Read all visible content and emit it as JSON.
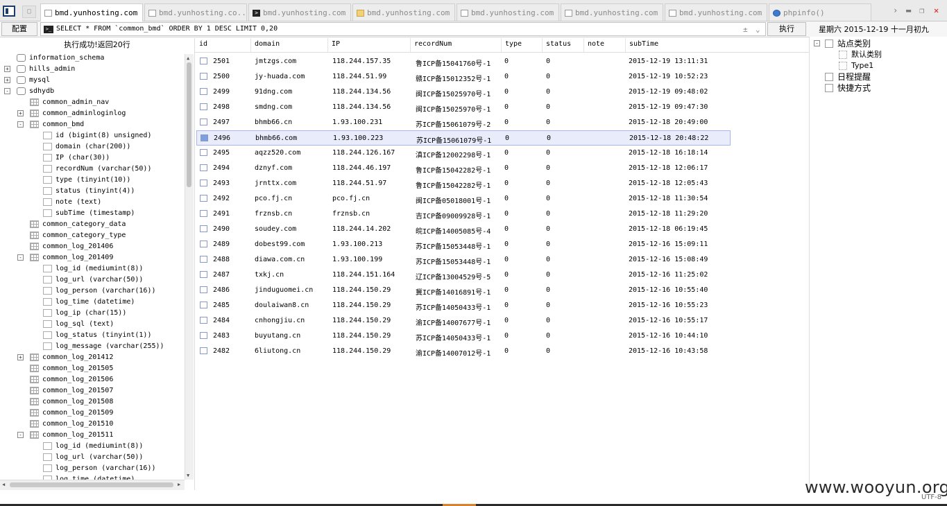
{
  "tabs": [
    {
      "label": "bmd.yunhosting.com",
      "icon": "page-icon",
      "active": true
    },
    {
      "label": "bmd.yunhosting.co...",
      "icon": "page-icon",
      "active": false
    },
    {
      "label": "bmd.yunhosting.com",
      "icon": "terminal-icon",
      "active": false
    },
    {
      "label": "bmd.yunhosting.com",
      "icon": "folder-icon",
      "active": false
    },
    {
      "label": "bmd.yunhosting.com",
      "icon": "page-icon",
      "active": false
    },
    {
      "label": "bmd.yunhosting.com",
      "icon": "page-icon",
      "active": false
    },
    {
      "label": "bmd.yunhosting.com",
      "icon": "page-icon",
      "active": false
    },
    {
      "label": "phpinfo()",
      "icon": "globe-icon",
      "active": false
    }
  ],
  "toolbar": {
    "config_label": "配置",
    "sql_query": "SELECT * FROM `common_bmd` ORDER BY 1 DESC LIMIT 0,20",
    "execute_label": "执行",
    "date_text": "星期六 2015-12-19 十一月初九"
  },
  "status_message": "执行成功!返回20行",
  "tree": [
    {
      "label": "information_schema",
      "level": 0,
      "expander": "",
      "icon": "database-icon"
    },
    {
      "label": "hills_admin",
      "level": 0,
      "expander": "+",
      "icon": "database-icon"
    },
    {
      "label": "mysql",
      "level": 0,
      "expander": "+",
      "icon": "database-icon"
    },
    {
      "label": "sdhydb",
      "level": 0,
      "expander": "-",
      "icon": "database-icon"
    },
    {
      "label": "common_admin_nav",
      "level": 1,
      "expander": "",
      "icon": "table-icon"
    },
    {
      "label": "common_adminloginlog",
      "level": 1,
      "expander": "+",
      "icon": "table-icon"
    },
    {
      "label": "common_bmd",
      "level": 1,
      "expander": "-",
      "icon": "table-icon"
    },
    {
      "label": "id (bigint(8) unsigned)",
      "level": 2,
      "expander": "",
      "icon": "column-icon"
    },
    {
      "label": "domain (char(200))",
      "level": 2,
      "expander": "",
      "icon": "column-icon"
    },
    {
      "label": "IP (char(30))",
      "level": 2,
      "expander": "",
      "icon": "column-icon"
    },
    {
      "label": "recordNum (varchar(50))",
      "level": 2,
      "expander": "",
      "icon": "column-icon"
    },
    {
      "label": "type (tinyint(10))",
      "level": 2,
      "expander": "",
      "icon": "column-icon"
    },
    {
      "label": "status (tinyint(4))",
      "level": 2,
      "expander": "",
      "icon": "column-icon"
    },
    {
      "label": "note (text)",
      "level": 2,
      "expander": "",
      "icon": "column-icon"
    },
    {
      "label": "subTime (timestamp)",
      "level": 2,
      "expander": "",
      "icon": "column-icon"
    },
    {
      "label": "common_category_data",
      "level": 1,
      "expander": "",
      "icon": "table-icon"
    },
    {
      "label": "common_category_type",
      "level": 1,
      "expander": "",
      "icon": "table-icon"
    },
    {
      "label": "common_log_201406",
      "level": 1,
      "expander": "",
      "icon": "table-icon"
    },
    {
      "label": "common_log_201409",
      "level": 1,
      "expander": "-",
      "icon": "table-icon"
    },
    {
      "label": "log_id (mediumint(8))",
      "level": 2,
      "expander": "",
      "icon": "column-icon"
    },
    {
      "label": "log_url (varchar(50))",
      "level": 2,
      "expander": "",
      "icon": "column-icon"
    },
    {
      "label": "log_person (varchar(16))",
      "level": 2,
      "expander": "",
      "icon": "column-icon"
    },
    {
      "label": "log_time (datetime)",
      "level": 2,
      "expander": "",
      "icon": "column-icon"
    },
    {
      "label": "log_ip (char(15))",
      "level": 2,
      "expander": "",
      "icon": "column-icon"
    },
    {
      "label": "log_sql (text)",
      "level": 2,
      "expander": "",
      "icon": "column-icon"
    },
    {
      "label": "log_status (tinyint(1))",
      "level": 2,
      "expander": "",
      "icon": "column-icon"
    },
    {
      "label": "log_message (varchar(255))",
      "level": 2,
      "expander": "",
      "icon": "column-icon"
    },
    {
      "label": "common_log_201412",
      "level": 1,
      "expander": "+",
      "icon": "table-icon"
    },
    {
      "label": "common_log_201505",
      "level": 1,
      "expander": "",
      "icon": "table-icon"
    },
    {
      "label": "common_log_201506",
      "level": 1,
      "expander": "",
      "icon": "table-icon"
    },
    {
      "label": "common_log_201507",
      "level": 1,
      "expander": "",
      "icon": "table-icon"
    },
    {
      "label": "common_log_201508",
      "level": 1,
      "expander": "",
      "icon": "table-icon"
    },
    {
      "label": "common_log_201509",
      "level": 1,
      "expander": "",
      "icon": "table-icon"
    },
    {
      "label": "common_log_201510",
      "level": 1,
      "expander": "",
      "icon": "table-icon"
    },
    {
      "label": "common_log_201511",
      "level": 1,
      "expander": "-",
      "icon": "table-icon"
    },
    {
      "label": "log_id (mediumint(8))",
      "level": 2,
      "expander": "",
      "icon": "column-icon"
    },
    {
      "label": "log_url (varchar(50))",
      "level": 2,
      "expander": "",
      "icon": "column-icon"
    },
    {
      "label": "log_person (varchar(16))",
      "level": 2,
      "expander": "",
      "icon": "column-icon"
    },
    {
      "label": "log_time (datetime)",
      "level": 2,
      "expander": "",
      "icon": "column-icon"
    }
  ],
  "grid": {
    "columns": [
      "id",
      "domain",
      "IP",
      "recordNum",
      "type",
      "status",
      "note",
      "subTime"
    ],
    "selected_row": 5,
    "rows": [
      [
        "2501",
        "jmtzgs.com",
        "118.244.157.35",
        "鲁ICP备15041760号-1",
        "0",
        "0",
        "",
        "2015-12-19 13:11:31"
      ],
      [
        "2500",
        "jy-huada.com",
        "118.244.51.99",
        "赣ICP备15012352号-1",
        "0",
        "0",
        "",
        "2015-12-19 10:52:23"
      ],
      [
        "2499",
        "91dng.com",
        "118.244.134.56",
        "闽ICP备15025970号-1",
        "0",
        "0",
        "",
        "2015-12-19 09:48:02"
      ],
      [
        "2498",
        "smdng.com",
        "118.244.134.56",
        "闽ICP备15025970号-1",
        "0",
        "0",
        "",
        "2015-12-19 09:47:30"
      ],
      [
        "2497",
        "bhmb66.cn",
        "1.93.100.231",
        "苏ICP备15061079号-2",
        "0",
        "0",
        "",
        "2015-12-18 20:49:00"
      ],
      [
        "2496",
        "bhmb66.com",
        "1.93.100.223",
        "苏ICP备15061079号-1",
        "0",
        "0",
        "",
        "2015-12-18 20:48:22"
      ],
      [
        "2495",
        "aqzz520.com",
        "118.244.126.167",
        "滇ICP备12002298号-1",
        "0",
        "0",
        "",
        "2015-12-18 16:18:14"
      ],
      [
        "2494",
        "dznyf.com",
        "118.244.46.197",
        "鲁ICP备15042282号-1",
        "0",
        "0",
        "",
        "2015-12-18 12:06:17"
      ],
      [
        "2493",
        "jrnttx.com",
        "118.244.51.97",
        "鲁ICP备15042282号-1",
        "0",
        "0",
        "",
        "2015-12-18 12:05:43"
      ],
      [
        "2492",
        "pco.fj.cn",
        "pco.fj.cn",
        "闽ICP备05018001号-1",
        "0",
        "0",
        "",
        "2015-12-18 11:30:54"
      ],
      [
        "2491",
        "frznsb.cn",
        "frznsb.cn",
        "吉ICP备09009928号-1",
        "0",
        "0",
        "",
        "2015-12-18 11:29:20"
      ],
      [
        "2490",
        "soudey.com",
        "118.244.14.202",
        "皖ICP备14005085号-4",
        "0",
        "0",
        "",
        "2015-12-18 06:19:45"
      ],
      [
        "2489",
        "dobest99.com",
        "1.93.100.213",
        "苏ICP备15053448号-1",
        "0",
        "0",
        "",
        "2015-12-16 15:09:11"
      ],
      [
        "2488",
        "diawa.com.cn",
        "1.93.100.199",
        "苏ICP备15053448号-1",
        "0",
        "0",
        "",
        "2015-12-16 15:08:49"
      ],
      [
        "2487",
        "txkj.cn",
        "118.244.151.164",
        "辽ICP备13004529号-5",
        "0",
        "0",
        "",
        "2015-12-16 11:25:02"
      ],
      [
        "2486",
        "jinduguomei.cn",
        "118.244.150.29",
        "冀ICP备14016891号-1",
        "0",
        "0",
        "",
        "2015-12-16 10:55:40"
      ],
      [
        "2485",
        "doulaiwan8.cn",
        "118.244.150.29",
        "苏ICP备14050433号-1",
        "0",
        "0",
        "",
        "2015-12-16 10:55:23"
      ],
      [
        "2484",
        "cnhongjiu.cn",
        "118.244.150.29",
        "渝ICP备14007677号-1",
        "0",
        "0",
        "",
        "2015-12-16 10:55:17"
      ],
      [
        "2483",
        "buyutang.cn",
        "118.244.150.29",
        "苏ICP备14050433号-1",
        "0",
        "0",
        "",
        "2015-12-16 10:44:10"
      ],
      [
        "2482",
        "6liutong.cn",
        "118.244.150.29",
        "渝ICP备14007012号-1",
        "0",
        "0",
        "",
        "2015-12-16 10:43:58"
      ]
    ]
  },
  "right_panel": {
    "items": [
      {
        "label": "站点类别",
        "level": 0,
        "expander": "-",
        "icon": "folder-icon"
      },
      {
        "label": "默认类别",
        "level": 1,
        "expander": "",
        "icon": "category-icon"
      },
      {
        "label": "Type1",
        "level": 1,
        "expander": "",
        "icon": "category-icon"
      },
      {
        "label": "日程提醒",
        "level": 0,
        "expander": "",
        "icon": "calendar-icon"
      },
      {
        "label": "快捷方式",
        "level": 0,
        "expander": "",
        "icon": "shortcut-icon"
      }
    ]
  },
  "footer": {
    "watermark": "www.wooyun.org",
    "encoding": "UTF-8"
  },
  "colors": {
    "selected_row_bg": "#e9edfb",
    "selected_row_border": "#a9b6ee",
    "close_button": "#dd1111",
    "footer_accent": "#d9822b"
  }
}
